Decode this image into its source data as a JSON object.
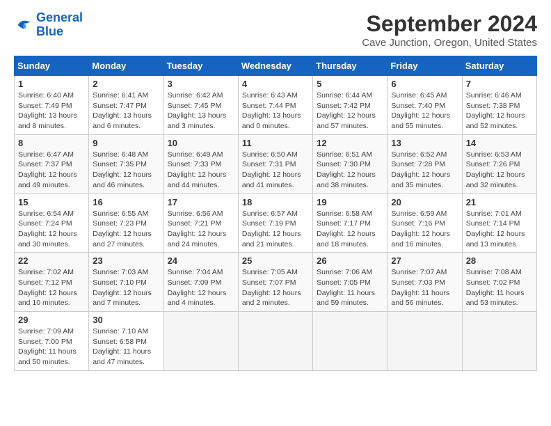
{
  "header": {
    "logo_line1": "General",
    "logo_line2": "Blue",
    "title": "September 2024",
    "subtitle": "Cave Junction, Oregon, United States"
  },
  "columns": [
    "Sunday",
    "Monday",
    "Tuesday",
    "Wednesday",
    "Thursday",
    "Friday",
    "Saturday"
  ],
  "weeks": [
    [
      {
        "day": "1",
        "detail": "Sunrise: 6:40 AM\nSunset: 7:49 PM\nDaylight: 13 hours\nand 8 minutes."
      },
      {
        "day": "2",
        "detail": "Sunrise: 6:41 AM\nSunset: 7:47 PM\nDaylight: 13 hours\nand 6 minutes."
      },
      {
        "day": "3",
        "detail": "Sunrise: 6:42 AM\nSunset: 7:45 PM\nDaylight: 13 hours\nand 3 minutes."
      },
      {
        "day": "4",
        "detail": "Sunrise: 6:43 AM\nSunset: 7:44 PM\nDaylight: 13 hours\nand 0 minutes."
      },
      {
        "day": "5",
        "detail": "Sunrise: 6:44 AM\nSunset: 7:42 PM\nDaylight: 12 hours\nand 57 minutes."
      },
      {
        "day": "6",
        "detail": "Sunrise: 6:45 AM\nSunset: 7:40 PM\nDaylight: 12 hours\nand 55 minutes."
      },
      {
        "day": "7",
        "detail": "Sunrise: 6:46 AM\nSunset: 7:38 PM\nDaylight: 12 hours\nand 52 minutes."
      }
    ],
    [
      {
        "day": "8",
        "detail": "Sunrise: 6:47 AM\nSunset: 7:37 PM\nDaylight: 12 hours\nand 49 minutes."
      },
      {
        "day": "9",
        "detail": "Sunrise: 6:48 AM\nSunset: 7:35 PM\nDaylight: 12 hours\nand 46 minutes."
      },
      {
        "day": "10",
        "detail": "Sunrise: 6:49 AM\nSunset: 7:33 PM\nDaylight: 12 hours\nand 44 minutes."
      },
      {
        "day": "11",
        "detail": "Sunrise: 6:50 AM\nSunset: 7:31 PM\nDaylight: 12 hours\nand 41 minutes."
      },
      {
        "day": "12",
        "detail": "Sunrise: 6:51 AM\nSunset: 7:30 PM\nDaylight: 12 hours\nand 38 minutes."
      },
      {
        "day": "13",
        "detail": "Sunrise: 6:52 AM\nSunset: 7:28 PM\nDaylight: 12 hours\nand 35 minutes."
      },
      {
        "day": "14",
        "detail": "Sunrise: 6:53 AM\nSunset: 7:26 PM\nDaylight: 12 hours\nand 32 minutes."
      }
    ],
    [
      {
        "day": "15",
        "detail": "Sunrise: 6:54 AM\nSunset: 7:24 PM\nDaylight: 12 hours\nand 30 minutes."
      },
      {
        "day": "16",
        "detail": "Sunrise: 6:55 AM\nSunset: 7:23 PM\nDaylight: 12 hours\nand 27 minutes."
      },
      {
        "day": "17",
        "detail": "Sunrise: 6:56 AM\nSunset: 7:21 PM\nDaylight: 12 hours\nand 24 minutes."
      },
      {
        "day": "18",
        "detail": "Sunrise: 6:57 AM\nSunset: 7:19 PM\nDaylight: 12 hours\nand 21 minutes."
      },
      {
        "day": "19",
        "detail": "Sunrise: 6:58 AM\nSunset: 7:17 PM\nDaylight: 12 hours\nand 18 minutes."
      },
      {
        "day": "20",
        "detail": "Sunrise: 6:59 AM\nSunset: 7:16 PM\nDaylight: 12 hours\nand 16 minutes."
      },
      {
        "day": "21",
        "detail": "Sunrise: 7:01 AM\nSunset: 7:14 PM\nDaylight: 12 hours\nand 13 minutes."
      }
    ],
    [
      {
        "day": "22",
        "detail": "Sunrise: 7:02 AM\nSunset: 7:12 PM\nDaylight: 12 hours\nand 10 minutes."
      },
      {
        "day": "23",
        "detail": "Sunrise: 7:03 AM\nSunset: 7:10 PM\nDaylight: 12 hours\nand 7 minutes."
      },
      {
        "day": "24",
        "detail": "Sunrise: 7:04 AM\nSunset: 7:09 PM\nDaylight: 12 hours\nand 4 minutes."
      },
      {
        "day": "25",
        "detail": "Sunrise: 7:05 AM\nSunset: 7:07 PM\nDaylight: 12 hours\nand 2 minutes."
      },
      {
        "day": "26",
        "detail": "Sunrise: 7:06 AM\nSunset: 7:05 PM\nDaylight: 11 hours\nand 59 minutes."
      },
      {
        "day": "27",
        "detail": "Sunrise: 7:07 AM\nSunset: 7:03 PM\nDaylight: 11 hours\nand 56 minutes."
      },
      {
        "day": "28",
        "detail": "Sunrise: 7:08 AM\nSunset: 7:02 PM\nDaylight: 11 hours\nand 53 minutes."
      }
    ],
    [
      {
        "day": "29",
        "detail": "Sunrise: 7:09 AM\nSunset: 7:00 PM\nDaylight: 11 hours\nand 50 minutes."
      },
      {
        "day": "30",
        "detail": "Sunrise: 7:10 AM\nSunset: 6:58 PM\nDaylight: 11 hours\nand 47 minutes."
      },
      {
        "day": "",
        "detail": ""
      },
      {
        "day": "",
        "detail": ""
      },
      {
        "day": "",
        "detail": ""
      },
      {
        "day": "",
        "detail": ""
      },
      {
        "day": "",
        "detail": ""
      }
    ]
  ]
}
